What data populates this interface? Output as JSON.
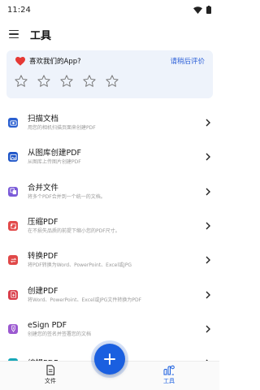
{
  "status_bar": {
    "time": "11:24"
  },
  "app_bar": {
    "title": "工具"
  },
  "rating": {
    "question": "喜欢我们的App?",
    "later": "请稍后评价",
    "stars": 5
  },
  "tools": [
    {
      "title": "扫描文档",
      "desc": "用您的相机扫描页面来创建PDF",
      "icon": "scan-icon",
      "color": "#2a5fd0"
    },
    {
      "title": "从图库创建PDF",
      "desc": "从图库上传图片创建PDF",
      "icon": "gallery-icon",
      "color": "#1e55c8"
    },
    {
      "title": "合并文件",
      "desc": "将多个PDF合并到一个统一的文档。",
      "icon": "merge-icon",
      "color": "#7a5ad8"
    },
    {
      "title": "压缩PDF",
      "desc": "在不损失品质的前提下缩小您的PDF尺寸。",
      "icon": "compress-icon",
      "color": "#e24a4a"
    },
    {
      "title": "转换PDF",
      "desc": "将PDF转换为Word、PowerPoint、Excel或JPG",
      "icon": "convert-icon",
      "color": "#e04848"
    },
    {
      "title": "创建PDF",
      "desc": "将Word、PowerPoint、Excel或JPG文件转换为PDF",
      "icon": "create-icon",
      "color": "#d93d4a"
    },
    {
      "title": "eSign PDF",
      "desc": "创建您的签名并签署您的文档",
      "icon": "esign-icon",
      "color": "#9b59d0"
    },
    {
      "title": "编辑PDF",
      "desc": "",
      "icon": "edit-icon",
      "color": "#17a7b8"
    }
  ],
  "bottom_nav": {
    "files": "文件",
    "tools": "工具"
  },
  "colors": {
    "accent": "#1a5fe0",
    "heart": "#e53935"
  }
}
